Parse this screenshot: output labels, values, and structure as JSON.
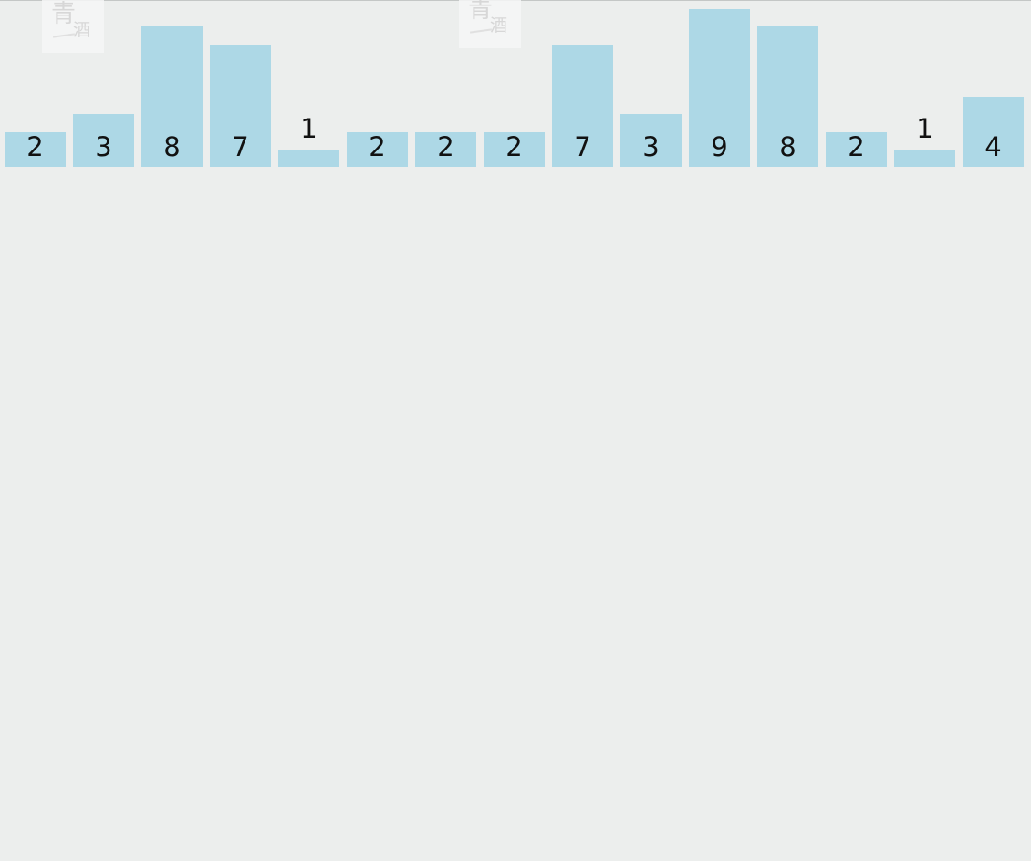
{
  "watermark": {
    "big_char": "青",
    "small_char": "酒"
  },
  "chart_data": {
    "type": "bar",
    "values": [
      2,
      3,
      8,
      7,
      1,
      2,
      2,
      2,
      7,
      3,
      9,
      8,
      2,
      1,
      4
    ],
    "colors": {
      "bar": "#add8e6",
      "background": "#eceeed",
      "label": "#111111"
    }
  }
}
